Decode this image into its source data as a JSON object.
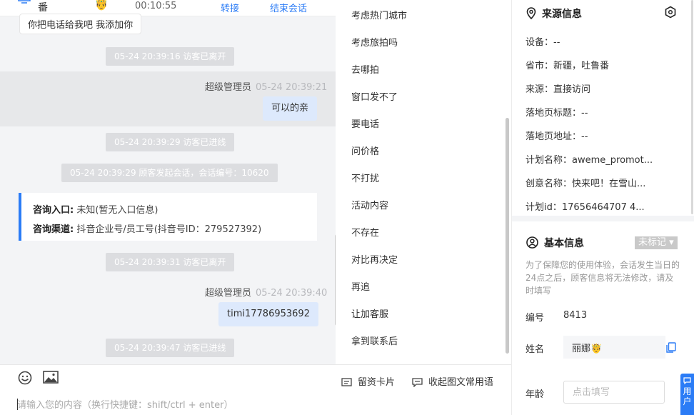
{
  "chat": {
    "header": {
      "visitor_name": "番",
      "timer": "00:10:55",
      "transfer_label": "转接",
      "end_label": "结束会话"
    },
    "partial_bubble": "你把电话给我吧  我添加你",
    "system_messages": [
      "05-24 20:39:16 访客已离开",
      "05-24 20:39:29 访客已进线",
      "05-24 20:39:29 顾客发起会话，会话编号：10620",
      "05-24 20:39:31 访客已离开",
      "05-24 20:39:47 访客已进线"
    ],
    "agent_messages": [
      {
        "sender": "超级管理员",
        "time": "05-24 20:39:21",
        "text": "可以的亲"
      },
      {
        "sender": "超级管理员",
        "time": "05-24 20:39:40",
        "text": "timi17786953692"
      }
    ],
    "consult_card": {
      "entry_label": "咨询入口:",
      "entry_value": " 未知(暂无入口信息)",
      "channel_label": "咨询渠道:",
      "channel_value": " 抖音企业号/员工号(抖音号ID：279527392)"
    }
  },
  "input_area": {
    "placeholder": "请输入您的内容（换行快捷键：shift/ctrl + enter）",
    "card_label": "留资卡片",
    "collapse_label": "收起图文常用语"
  },
  "quick_replies": [
    "考虑热门城市",
    "考虑旅拍吗",
    "去哪拍",
    "窗口发不了",
    "要电话",
    "问价格",
    "不打扰",
    "活动内容",
    "不存在",
    "对比再决定",
    "再追",
    "让加客服",
    "拿到联系后"
  ],
  "source_info": {
    "title": "来源信息",
    "rows": [
      "设备：--",
      "省市：新疆，吐鲁番",
      "来源：直接访问",
      "落地页标题：--",
      "落地页地址：--",
      "计划名称：aweme_promot...",
      "创意名称：快来吧！在雪山...",
      "计划id：17656464707 4..."
    ]
  },
  "basic_info": {
    "title": "基本信息",
    "tag_select": "未标记",
    "hint": "为了保障您的使用体验，会话发生当日的24点之后，顾客信息将无法修改，请及时填写",
    "id_label": "编号",
    "id_value": "8413",
    "name_label": "姓名",
    "name_value": "丽娜",
    "age_label": "年龄",
    "age_placeholder": "点击填写",
    "float_label": "用户"
  },
  "colors": {
    "accent": "#2b7cf6",
    "agent_bubble": "#dde9fc",
    "system_badge": "#dcdde0",
    "chat_bg": "#f3f4f6"
  }
}
